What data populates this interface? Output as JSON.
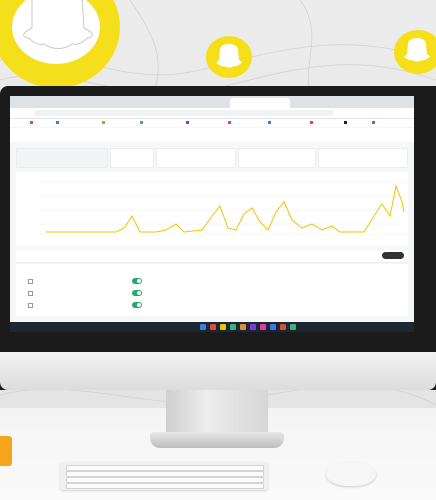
{
  "colors": {
    "accent_yellow": "#f0c400",
    "logo_yellow": "#f5df1a",
    "toggle_green": "#27a86a",
    "taskbar": "#1d2733"
  },
  "icons": {
    "wall_logos": [
      "ghost-logo-icon",
      "ghost-logo-icon",
      "ghost-logo-icon"
    ]
  }
}
